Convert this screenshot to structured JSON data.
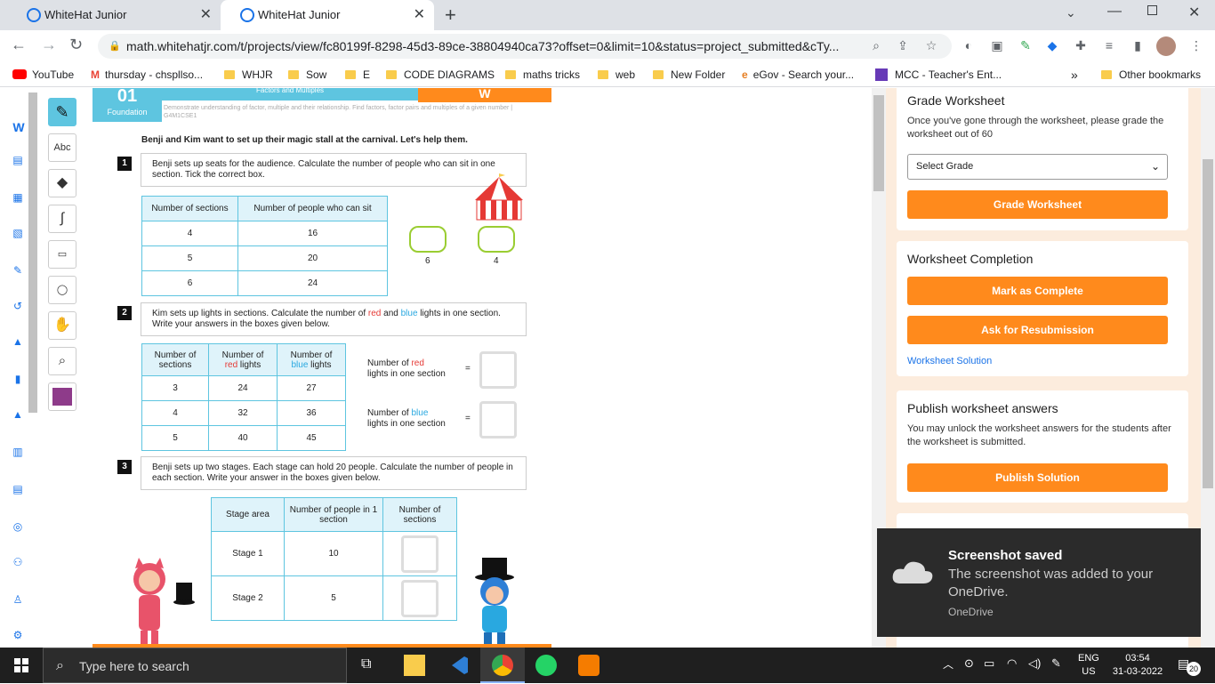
{
  "browser": {
    "tabs": [
      {
        "title": "WhiteHat Junior"
      },
      {
        "title": "WhiteHat Junior"
      }
    ],
    "new_tab": "+",
    "url": "math.whitehatjr.com/t/projects/view/fc80199f-8298-45d3-89ce-38804940ca73?offset=0&limit=10&status=project_submitted&cTy...",
    "bookmarks": [
      "YouTube",
      "thursday - chspllso...",
      "WHJR",
      "Sow",
      "E",
      "CODE DIAGRAMS",
      "maths tricks",
      "web",
      "New Folder",
      "eGov - Search your...",
      "MCC - Teacher's Ent..."
    ],
    "more_bookmarks": "»",
    "other_bookmarks": "Other bookmarks"
  },
  "tools": {
    "text_tool": "Abc"
  },
  "worksheet": {
    "badge_number": "01",
    "badge_label": "Foundation",
    "topic": "Factors and Multiples",
    "tag": "W",
    "description": "Demonstrate understanding of factor, multiple and their relationship. Find factors, factor pairs and multiples of a given number | G4M1CSE1",
    "intro": "Benji and Kim want to set up their magic stall at the carnival. Let's help them.",
    "q1": {
      "num": "1",
      "text": "Benji sets up seats for the audience. Calculate the number of people who can sit in one section. Tick the correct box.",
      "headers": [
        "Number of sections",
        "Number of people who can sit"
      ],
      "rows": [
        [
          "4",
          "16"
        ],
        [
          "5",
          "20"
        ],
        [
          "6",
          "24"
        ]
      ],
      "options": [
        "6",
        "4"
      ]
    },
    "q2": {
      "num": "2",
      "text_a": "Kim sets up lights in sections. Calculate the number of ",
      "red": "red",
      "and": " and ",
      "blue": "blue",
      "text_b": " lights in one section. Write your answers in the boxes given below.",
      "headers": [
        "Number of sections",
        "Number of red lights",
        "Number of blue lights"
      ],
      "rows": [
        [
          "3",
          "24",
          "27"
        ],
        [
          "4",
          "32",
          "36"
        ],
        [
          "5",
          "40",
          "45"
        ]
      ],
      "red_label_a": "Number of ",
      "red_label_b": "lights in one section",
      "blue_label_a": "Number of ",
      "blue_label_b": "lights in one section",
      "eq": "="
    },
    "q3": {
      "num": "3",
      "text": "Benji sets up two stages. Each stage can hold 20 people. Calculate the number of people in each section. Write your answer in the boxes given below.",
      "headers": [
        "Stage area",
        "Number of people in 1 section",
        "Number of sections"
      ],
      "rows": [
        [
          "Stage 1",
          "10"
        ],
        [
          "Stage 2",
          "5"
        ]
      ]
    }
  },
  "panel": {
    "grade": {
      "title": "Grade Worksheet",
      "desc": "Once you've gone through the worksheet, please grade the worksheet out of 60",
      "select": "Select Grade",
      "button": "Grade Worksheet"
    },
    "completion": {
      "title": "Worksheet Completion",
      "complete": "Mark as Complete",
      "resubmit": "Ask for Resubmission",
      "solution_link": "Worksheet Solution"
    },
    "publish": {
      "title": "Publish worksheet answers",
      "desc": "You may unlock the worksheet answers for the students after the worksheet is submitted.",
      "button": "Publish Solution"
    }
  },
  "toast": {
    "title": "Screenshot saved",
    "body": "The screenshot was added to your OneDrive.",
    "source": "OneDrive"
  },
  "taskbar": {
    "search_placeholder": "Type here to search",
    "lang_a": "ENG",
    "lang_b": "US",
    "time": "03:54",
    "date": "31-03-2022",
    "notifications": "20"
  },
  "colors": {
    "accent": "#ff8a1c",
    "teal": "#5ec5e0",
    "panel_bg": "#fcecdd",
    "red": "#e53935",
    "blue": "#29a8e0"
  }
}
